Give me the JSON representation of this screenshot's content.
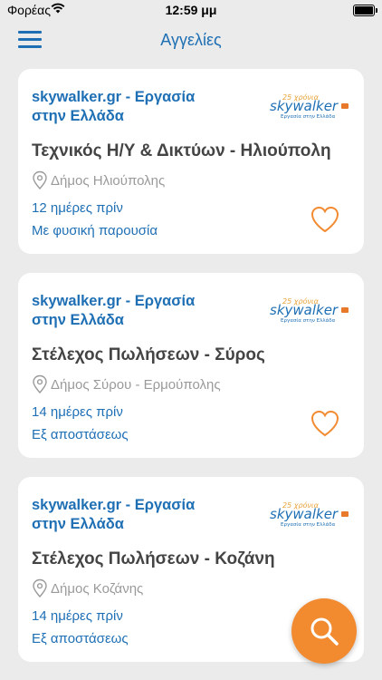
{
  "status_bar": {
    "carrier": "Φορέας",
    "time": "12:59 μμ"
  },
  "nav": {
    "title": "Αγγελίες",
    "menu_icon": "hamburger-menu-icon"
  },
  "colors": {
    "primary": "#1e6fb4",
    "accent": "#f28a30",
    "background": "#ebebeb"
  },
  "jobs": [
    {
      "company": "skywalker.gr - Εργασία στην Ελλάδα",
      "title": "Τεχνικός Η/Υ & Δικτύων - Ηλιούπολη",
      "location": "Δήμος Ηλιούπολης",
      "posted": "12 ημέρες πρίν",
      "work_mode": "Με φυσική παρουσία",
      "favorite_icon": "heart-outline-icon"
    },
    {
      "company": "skywalker.gr - Εργασία στην Ελλάδα",
      "title": "Στέλεχος Πωλήσεων - Σύρος",
      "location": "Δήμος Σύρου - Ερμούπολης",
      "posted": "14 ημέρες πρίν",
      "work_mode": "Εξ αποστάσεως",
      "favorite_icon": "heart-outline-icon"
    },
    {
      "company": "skywalker.gr - Εργασία στην Ελλάδα",
      "title": "Στέλεχος Πωλήσεων - Κοζάνη",
      "location": "Δήμος Κοζάνης",
      "posted": "14 ημέρες πρίν",
      "work_mode": "Εξ αποστάσεως"
    }
  ],
  "logo": {
    "badge": "25 χρόνια",
    "brand": "skywalker",
    "tagline": "Εργασία στην Ελλάδα"
  },
  "search_fab": {
    "icon": "search-icon"
  }
}
